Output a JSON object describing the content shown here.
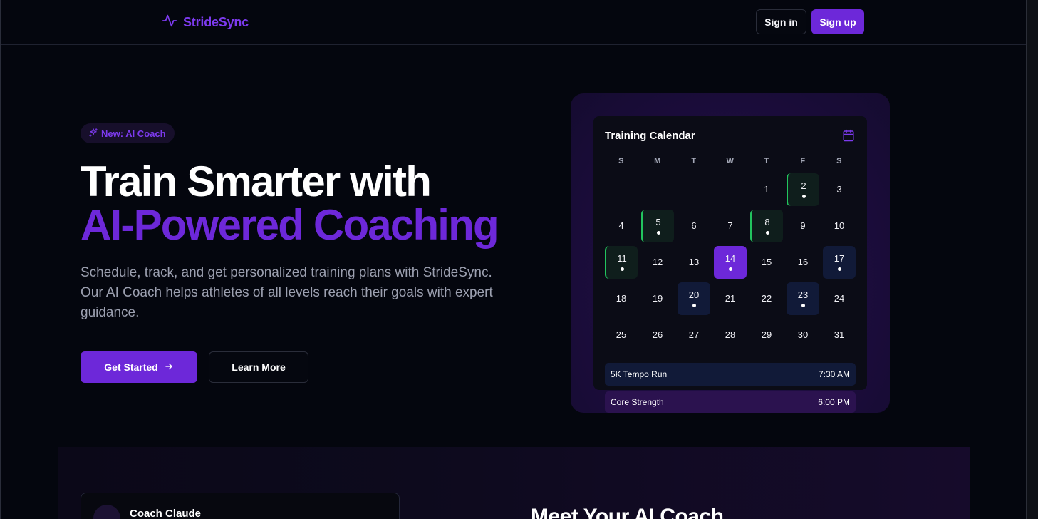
{
  "header": {
    "logo_text": "StrideSync",
    "signin_label": "Sign in",
    "signup_label": "Sign up"
  },
  "hero": {
    "badge": "New: AI Coach",
    "title_line1": "Train Smarter with",
    "title_line2": "AI-Powered Coaching",
    "description": "Schedule, track, and get personalized training plans with StrideSync. Our AI Coach helps athletes of all levels reach their goals with expert guidance.",
    "primary_cta": "Get Started",
    "secondary_cta": "Learn More"
  },
  "calendar": {
    "title": "Training Calendar",
    "weekdays": [
      "S",
      "M",
      "T",
      "W",
      "T",
      "F",
      "S"
    ],
    "days": [
      {
        "n": "1",
        "style": "plain",
        "dot": false
      },
      {
        "n": "2",
        "style": "green",
        "dot": true
      },
      {
        "n": "3",
        "style": "plain",
        "dot": false
      },
      {
        "n": "4",
        "style": "plain",
        "dot": false
      },
      {
        "n": "5",
        "style": "green",
        "dot": true
      },
      {
        "n": "6",
        "style": "plain",
        "dot": false
      },
      {
        "n": "7",
        "style": "plain",
        "dot": false
      },
      {
        "n": "8",
        "style": "green",
        "dot": true
      },
      {
        "n": "9",
        "style": "plain",
        "dot": false
      },
      {
        "n": "10",
        "style": "plain",
        "dot": false
      },
      {
        "n": "11",
        "style": "green",
        "dot": true
      },
      {
        "n": "12",
        "style": "plain",
        "dot": false
      },
      {
        "n": "13",
        "style": "plain",
        "dot": false
      },
      {
        "n": "14",
        "style": "active",
        "dot": true
      },
      {
        "n": "15",
        "style": "plain",
        "dot": false
      },
      {
        "n": "16",
        "style": "plain",
        "dot": false
      },
      {
        "n": "17",
        "style": "blue",
        "dot": true
      },
      {
        "n": "18",
        "style": "plain",
        "dot": false
      },
      {
        "n": "19",
        "style": "plain",
        "dot": false
      },
      {
        "n": "20",
        "style": "blue",
        "dot": true
      },
      {
        "n": "21",
        "style": "plain",
        "dot": false
      },
      {
        "n": "22",
        "style": "plain",
        "dot": false
      },
      {
        "n": "23",
        "style": "blue",
        "dot": true
      },
      {
        "n": "24",
        "style": "plain",
        "dot": false
      },
      {
        "n": "25",
        "style": "plain",
        "dot": false
      },
      {
        "n": "26",
        "style": "plain",
        "dot": false
      },
      {
        "n": "27",
        "style": "plain",
        "dot": false
      },
      {
        "n": "28",
        "style": "plain",
        "dot": false
      },
      {
        "n": "29",
        "style": "plain",
        "dot": false
      },
      {
        "n": "30",
        "style": "plain",
        "dot": false
      },
      {
        "n": "31",
        "style": "plain",
        "dot": false
      }
    ],
    "events": [
      {
        "name": "5K Tempo Run",
        "time": "7:30 AM"
      },
      {
        "name": "Core Strength",
        "time": "6:00 PM"
      }
    ]
  },
  "coach": {
    "name": "Coach Claude",
    "section_title": "Meet Your AI Coach"
  },
  "icons": {
    "logo": "activity-pulse-icon",
    "badge": "sparkles-icon",
    "cta": "arrow-right-icon",
    "calendar": "calendar-icon"
  },
  "colors": {
    "accent": "#6d28d9",
    "brand_text": "#7c3aed",
    "background": "#04060e",
    "completed": "#22c55e",
    "scheduled": "#111a38"
  }
}
